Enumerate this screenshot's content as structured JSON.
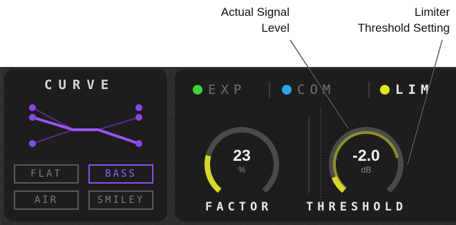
{
  "callouts": {
    "signal_line1": "Actual Signal",
    "signal_line2": "Level",
    "threshold_line1": "Limiter",
    "threshold_line2": "Threshold Setting"
  },
  "curve": {
    "title": "CURVE",
    "presets": [
      {
        "label": "FLAT",
        "active": false
      },
      {
        "label": "BASS",
        "active": true
      },
      {
        "label": "AIR",
        "active": false
      },
      {
        "label": "SMILEY",
        "active": false
      }
    ]
  },
  "modes": [
    {
      "label": "EXP",
      "dot_color": "#3fd23f",
      "active": false
    },
    {
      "label": "COM",
      "dot_color": "#2ea8e6",
      "active": false
    },
    {
      "label": "LIM",
      "dot_color": "#e3e31f",
      "active": true
    }
  ],
  "factor": {
    "value": "23",
    "unit": "%",
    "label": "FACTOR",
    "level": 0.23
  },
  "threshold": {
    "value": "-2.0",
    "unit": "dB",
    "label": "THRESHOLD",
    "level": 0.1,
    "signal_level": 0.78
  },
  "colors": {
    "accent_purple": "#8d4df0",
    "knob_track": "#4a4a4a",
    "knob_active": "#d7d72a"
  }
}
